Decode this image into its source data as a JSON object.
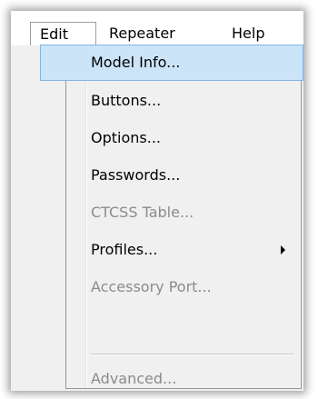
{
  "menubar": {
    "items": [
      {
        "label": "Edit"
      },
      {
        "label": "Repeater"
      },
      {
        "label": "Help"
      }
    ]
  },
  "dropdown": {
    "items": [
      {
        "label": "Model Info...",
        "enabled": true,
        "highlighted": true
      },
      {
        "label": "Buttons...",
        "enabled": true
      },
      {
        "label": "Options...",
        "enabled": true
      },
      {
        "label": "Passwords...",
        "enabled": true
      },
      {
        "label": "CTCSS Table...",
        "enabled": false
      },
      {
        "label": "Profiles...",
        "enabled": true,
        "submenu": true
      },
      {
        "label": "Accessory Port...",
        "enabled": false
      },
      {
        "label": "Advanced...",
        "enabled": false
      }
    ]
  },
  "colors": {
    "highlight_fill": "#cce4f7",
    "highlight_border": "#84b4e4",
    "menu_background": "#f0f0f0",
    "disabled_text": "#8b8b8b"
  },
  "icons": {
    "submenu_arrow": "triangle-right"
  }
}
